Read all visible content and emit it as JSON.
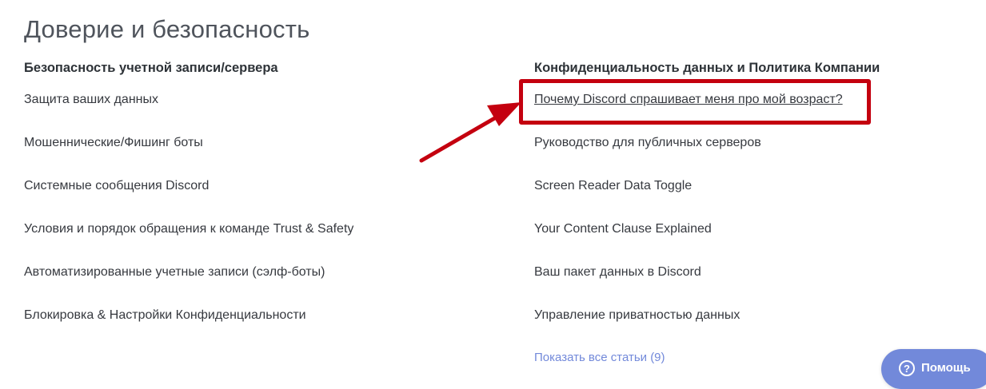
{
  "page": {
    "title": "Доверие и безопасность"
  },
  "sections": {
    "left": {
      "heading": "Безопасность учетной записи/сервера",
      "articles": [
        "Защита ваших данных",
        "Мошеннические/Фишинг боты",
        "Системные сообщения Discord",
        "Условия и порядок обращения к команде Trust & Safety",
        "Автоматизированные учетные записи (сэлф-боты)",
        "Блокировка & Настройки Конфиденциальности"
      ]
    },
    "right": {
      "heading": "Конфиденциальность данных и Политика Компании",
      "articles": [
        "Почему Discord спрашивает меня про мой возраст?",
        "Руководство для публичных серверов",
        "Screen Reader Data Toggle",
        "Your Content Clause Explained",
        "Ваш пакет данных в Discord",
        "Управление приватностью данных"
      ],
      "show_all": "Показать все статьи (9)"
    }
  },
  "help_widget": {
    "label": "Помощь",
    "icon": "question-circle-icon"
  },
  "colors": {
    "annotation": "#c4000f",
    "link_accent": "#7289da",
    "help_button": "#7289da"
  }
}
